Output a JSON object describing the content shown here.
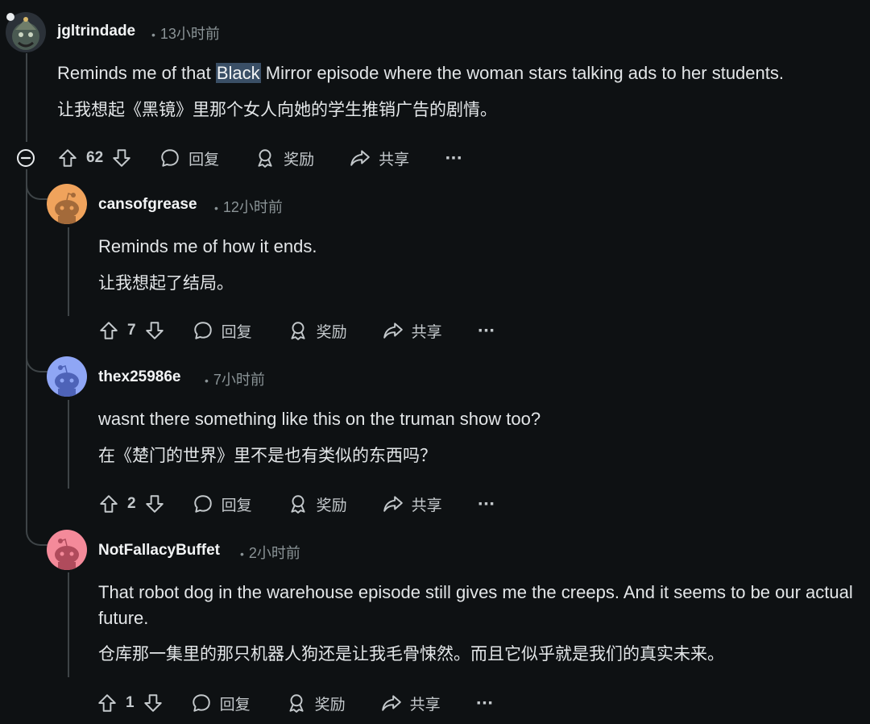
{
  "comments": [
    {
      "username": "jgltrindade",
      "time": "13小时前",
      "text_en_before": "Reminds me of that ",
      "text_en_highlight": "Black",
      "text_en_after": " Mirror episode where the woman stars talking ads to her students.",
      "text_zh": "让我想起《黑镜》里那个女人向她的学生推销广告的剧情。",
      "votes": "62",
      "reply_label": "回复",
      "award_label": "奖励",
      "share_label": "共享",
      "more_label": "···"
    },
    {
      "username": "cansofgrease",
      "time": "12小时前",
      "text_en": "Reminds me of how it ends.",
      "text_zh": "让我想起了结局。",
      "votes": "7",
      "reply_label": "回复",
      "award_label": "奖励",
      "share_label": "共享",
      "more_label": "···",
      "avatar_color": "#f0a35c"
    },
    {
      "username": "thex25986e",
      "time": "7小时前",
      "text_en": "wasnt there something like this on the truman show too?",
      "text_zh": "在《楚门的世界》里不是也有类似的东西吗？",
      "votes": "2",
      "reply_label": "回复",
      "award_label": "奖励",
      "share_label": "共享",
      "more_label": "···",
      "avatar_color": "#8fa6f5"
    },
    {
      "username": "NotFallacyBuffet",
      "time": "2小时前",
      "text_en": "That robot dog in the warehouse episode still gives me the creeps. And it seems to be our actual future.",
      "text_zh": "仓库那一集里的那只机器人狗还是让我毛骨悚然。而且它似乎就是我们的真实未来。",
      "votes": "1",
      "reply_label": "回复",
      "award_label": "奖励",
      "share_label": "共享",
      "more_label": "···",
      "avatar_color": "#f48a9a"
    }
  ],
  "icons": {
    "collapse": "minus-circle-icon",
    "upvote": "arrow-up-icon",
    "downvote": "arrow-down-icon",
    "reply": "speech-bubble-icon",
    "award": "award-icon",
    "share": "share-arrow-icon"
  }
}
